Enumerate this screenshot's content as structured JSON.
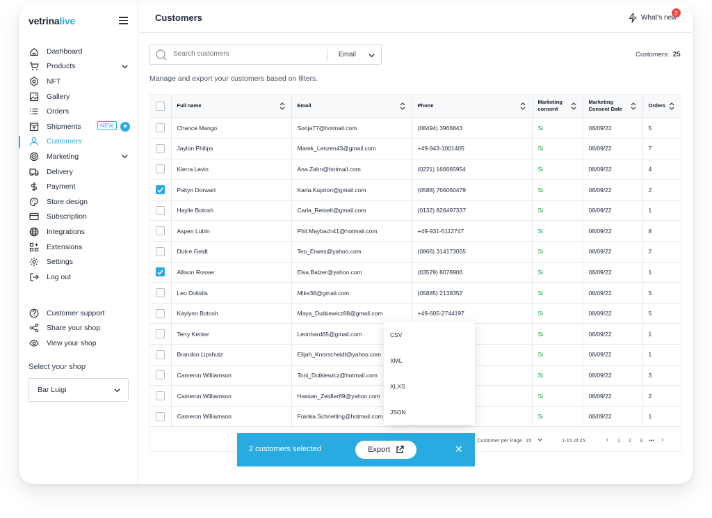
{
  "brand": {
    "logo_main": "vetrina",
    "logo_accent": "live"
  },
  "sidebar": {
    "items": [
      {
        "label": "Dashboard",
        "icon": "home-icon"
      },
      {
        "label": "Products",
        "icon": "cart-icon"
      },
      {
        "label": "NFT",
        "icon": "nft-icon"
      },
      {
        "label": "Gallery",
        "icon": "image-icon"
      },
      {
        "label": "Orders",
        "icon": "list-icon"
      },
      {
        "label": "Shipments",
        "icon": "box-icon",
        "badge": "NEW"
      },
      {
        "label": "Customers",
        "icon": "user-icon"
      },
      {
        "label": "Marketing",
        "icon": "target-icon"
      },
      {
        "label": "Delivery",
        "icon": "truck-icon"
      },
      {
        "label": "Payment",
        "icon": "dollar-icon"
      },
      {
        "label": "Store design",
        "icon": "palette-icon"
      },
      {
        "label": "Subscription",
        "icon": "card-icon"
      },
      {
        "label": "Integrations",
        "icon": "globe-icon"
      },
      {
        "label": "Extensions",
        "icon": "grid-plus-icon"
      },
      {
        "label": "Settings",
        "icon": "gear-icon"
      },
      {
        "label": "Log out",
        "icon": "logout-icon"
      }
    ],
    "secondary": [
      {
        "label": "Customer support",
        "icon": "help-icon"
      },
      {
        "label": "Share your shop",
        "icon": "share-icon"
      },
      {
        "label": "View your shop",
        "icon": "eye-icon"
      }
    ],
    "select_label": "Select your shop",
    "shop_value": "Bar Luigi"
  },
  "header": {
    "title": "Customers",
    "whats_new": "What's new",
    "notif_count": "2"
  },
  "filters": {
    "search_placeholder": "Search customers",
    "field": "Email",
    "count_label": "Customers:",
    "count_value": "25",
    "description": "Manage and export your customers based on filters."
  },
  "table": {
    "columns": [
      "Full name",
      "Email",
      "Phone",
      "Marketing\nconsent",
      "Marketing\nConsent Date",
      "Orders"
    ],
    "rows": [
      {
        "checked": false,
        "name": "Chance Mango",
        "email": "Sonja77@hotmail.com",
        "phone": "(08494) 3966843",
        "consent": "Si",
        "date": "08/09/22",
        "orders": "5"
      },
      {
        "checked": false,
        "name": "Jaylon Philips",
        "email": "Marek_Lenzen43@gmail.com",
        "phone": "+49-943-1001405",
        "consent": "Si",
        "date": "08/09/22",
        "orders": "7"
      },
      {
        "checked": false,
        "name": "Kierra Levin",
        "email": "Ana.Zahn@hotmail.com",
        "phone": "(0221) 166665954",
        "consent": "Si",
        "date": "08/09/22",
        "orders": "4"
      },
      {
        "checked": true,
        "name": "Paityn Dorwart",
        "email": "Karla.Kuprion@gmail.com",
        "phone": "(0588) 766060479",
        "consent": "Si",
        "date": "08/09/22",
        "orders": "2"
      },
      {
        "checked": false,
        "name": "Haylie Botosh",
        "email": "Carla_Reinelt@gmail.com",
        "phone": "(0132) 826497337",
        "consent": "Si",
        "date": "08/09/22",
        "orders": "1"
      },
      {
        "checked": false,
        "name": "Aspen Lubin",
        "email": "Phil.Maybach41@hotmail.com",
        "phone": "+49-931-5112747",
        "consent": "Si",
        "date": "08/09/22",
        "orders": "8"
      },
      {
        "checked": false,
        "name": "Dulce Geidt",
        "email": "Teo_Erwes@yahoo.com",
        "phone": "(0866) 314173055",
        "consent": "Si",
        "date": "08/09/22",
        "orders": "2"
      },
      {
        "checked": true,
        "name": "Allison Rosser",
        "email": "Elsa.Balzer@yahoo.com",
        "phone": "(03529) 8078906",
        "consent": "Si",
        "date": "08/09/22",
        "orders": "1"
      },
      {
        "checked": false,
        "name": "Leo Dokidis",
        "email": "Mike36@gmail.com",
        "phone": "(05885) 2138352",
        "consent": "Si",
        "date": "08/09/22",
        "orders": "5"
      },
      {
        "checked": false,
        "name": "Kaylynn Botosh",
        "email": "Maya_Dutkiewicz88@gmail.com",
        "phone": "+49-605-2744197",
        "consent": "Si",
        "date": "08/09/22",
        "orders": "5"
      },
      {
        "checked": false,
        "name": "Terry Kenter",
        "email": "Leonhard65@gmail.com",
        "phone": "",
        "consent": "Si",
        "date": "08/09/22",
        "orders": "1"
      },
      {
        "checked": false,
        "name": "Brandon Lipshutz",
        "email": "Elijah_Knorscheidt@yahoo.com",
        "phone": "",
        "consent": "Si",
        "date": "08/09/22",
        "orders": "1"
      },
      {
        "checked": false,
        "name": "Cameron Williamson",
        "email": "Toni_Dutkiewicz@hotmail.com",
        "phone": "",
        "consent": "Si",
        "date": "08/09/22",
        "orders": "3"
      },
      {
        "checked": false,
        "name": "Cameron Williamson",
        "email": "Hassan_Zeidler89@yahoo.com",
        "phone": "",
        "consent": "Si",
        "date": "08/09/22",
        "orders": "2"
      },
      {
        "checked": false,
        "name": "Cameron Williamson",
        "email": "Franka.Schnelting@hotmail.com",
        "phone": "",
        "consent": "Si",
        "date": "08/09/22",
        "orders": "1"
      }
    ]
  },
  "pagination": {
    "per_page_label": "Customer per Page",
    "per_page_value": "15",
    "range": "1-15 of 25",
    "prev": "‹",
    "pages": [
      "1",
      "2",
      "3",
      "•••"
    ],
    "next": "›"
  },
  "export_menu": {
    "options": [
      "CSV",
      "XML",
      "XLXS",
      "JSON"
    ]
  },
  "toast": {
    "text": "2 customers selected",
    "button": "Export",
    "close": "✕"
  },
  "colors": {
    "accent": "#29abe2",
    "consent": "#16a34a",
    "notif": "#ef4444"
  }
}
